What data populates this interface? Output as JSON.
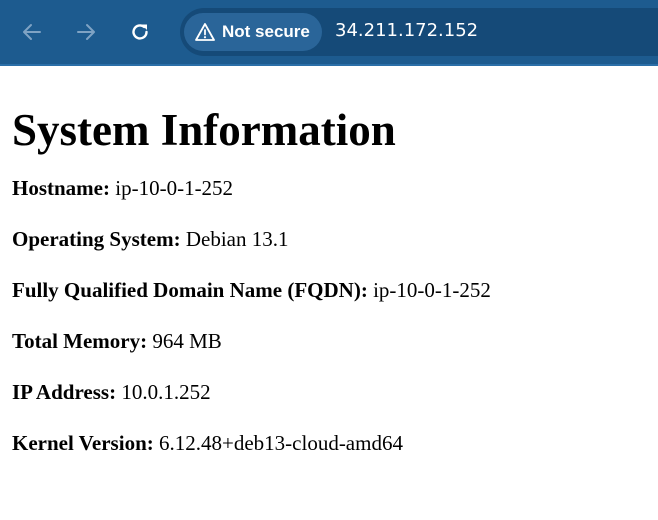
{
  "browser": {
    "back_icon": "arrow-left-icon",
    "forward_icon": "arrow-right-icon",
    "reload_icon": "reload-icon",
    "security_icon": "warning-triangle-icon",
    "security_label": "Not secure",
    "url": "34.211.172.152",
    "colors": {
      "toolbar": "#1d5b8f",
      "omnibox": "#154a78",
      "security_chip": "#2a6599"
    }
  },
  "page": {
    "title": "System Information",
    "items": [
      {
        "label": "Hostname:",
        "value": "ip-10-0-1-252"
      },
      {
        "label": "Operating System:",
        "value": "Debian 13.1"
      },
      {
        "label": "Fully Qualified Domain Name (FQDN):",
        "value": "ip-10-0-1-252"
      },
      {
        "label": "Total Memory:",
        "value": "964 MB"
      },
      {
        "label": "IP Address:",
        "value": "10.0.1.252"
      },
      {
        "label": "Kernel Version:",
        "value": "6.12.48+deb13-cloud-amd64"
      }
    ]
  }
}
